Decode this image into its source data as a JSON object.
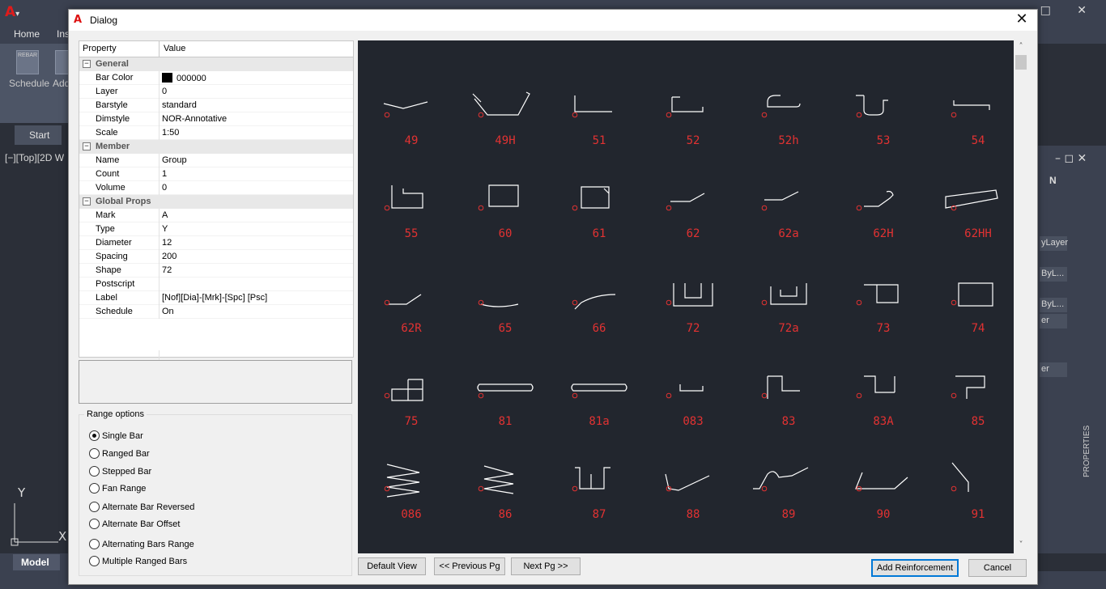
{
  "background": {
    "logo": "A",
    "logo_arrow": "▾",
    "ribbon_tabs": [
      "Home",
      "Ins"
    ],
    "ribbon_button_caption": "REBAR",
    "ribbon_labels": [
      "Schedule",
      "Add"
    ],
    "start_tab": "Start",
    "viewport_label": "[−][Top][2D W",
    "ucs_y": "Y",
    "ucs_x": "X",
    "model_tab": "Model",
    "right_panel_head": "N",
    "right_panel_rows": [
      "yLayer",
      "ByL...",
      "ByL...",
      "er",
      "er"
    ],
    "properties_label": "PROPERTIES",
    "window_controls": "– □ ✕"
  },
  "dialog": {
    "icon": "A",
    "title": "Dialog",
    "close_glyph": "✕"
  },
  "property_grid": {
    "header_property": "Property",
    "header_value": "Value",
    "categories": [
      {
        "name": "General",
        "rows": [
          {
            "name": "Bar Color",
            "value": "000000",
            "swatch": "#000000"
          },
          {
            "name": "Layer",
            "value": "0"
          },
          {
            "name": "Barstyle",
            "value": "standard"
          },
          {
            "name": "Dimstyle",
            "value": "NOR-Annotative"
          },
          {
            "name": "Scale",
            "value": "1:50"
          }
        ]
      },
      {
        "name": "Member",
        "rows": [
          {
            "name": "Name",
            "value": "Group"
          },
          {
            "name": "Count",
            "value": "1"
          },
          {
            "name": "Volume",
            "value": "0"
          }
        ]
      },
      {
        "name": "Global Props",
        "rows": [
          {
            "name": "Mark",
            "value": "A"
          },
          {
            "name": "Type",
            "value": "Y"
          },
          {
            "name": "Diameter",
            "value": "12"
          },
          {
            "name": "Spacing",
            "value": "200"
          },
          {
            "name": "Shape",
            "value": "72"
          },
          {
            "name": "Postscript",
            "value": ""
          },
          {
            "name": "Label",
            "value": "[Nof][Dia]-[Mrk]-[Spc] [Psc]"
          },
          {
            "name": "Schedule",
            "value": "On"
          }
        ]
      }
    ],
    "collapse_glyph": "−"
  },
  "range_options": {
    "legend": "Range options",
    "selected": "Single Bar",
    "options": [
      "Single Bar",
      "Ranged Bar",
      "Stepped Bar",
      "Fan Range",
      "Alternate Bar Reversed",
      "Alternate Bar Offset",
      "Alternating Bars Range",
      "Multiple Ranged Bars"
    ]
  },
  "gallery": {
    "background": "#22262e",
    "shape_color": "#ffffff",
    "label_color": "#e23232",
    "scroll_up": "˄",
    "scroll_down": "˅",
    "shapes": [
      [
        "49",
        "49H",
        "51",
        "52",
        "52h",
        "53",
        "54"
      ],
      [
        "55",
        "60",
        "61",
        "62",
        "62a",
        "62H",
        "62HH"
      ],
      [
        "62R",
        "65",
        "66",
        "72",
        "72a",
        "73",
        "74"
      ],
      [
        "75",
        "81",
        "81a",
        "083",
        "83",
        "83A",
        "85"
      ],
      [
        "086",
        "86",
        "87",
        "88",
        "89",
        "90",
        "91"
      ]
    ]
  },
  "buttons": {
    "default_view": "Default View",
    "previous_page": "<< Previous Pg",
    "next_page": "Next  Pg >>",
    "add_reinforcement": "Add Reinforcement",
    "cancel": "Cancel"
  }
}
